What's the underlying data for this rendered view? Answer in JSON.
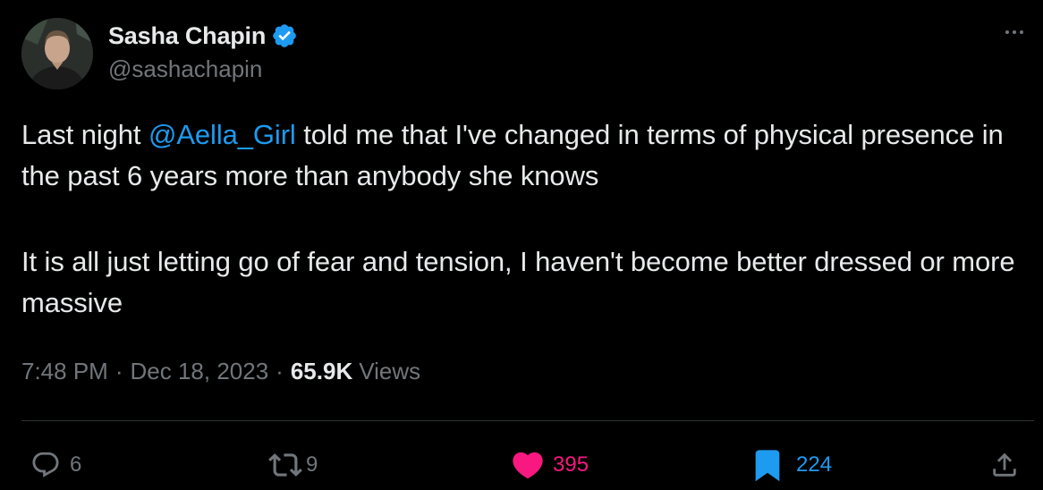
{
  "author": {
    "display_name": "Sasha Chapin",
    "handle": "@sashachapin",
    "verified": true,
    "avatar": "avatar-photo"
  },
  "tweet": {
    "paragraph1": {
      "before_mention": "Last night ",
      "mention": "@Aella_Girl",
      "after_mention": " told me that I've changed in terms of physical presence in the past 6 years more than anybody she knows"
    },
    "paragraph2": "It is all just letting go of fear and tension, I haven't become better dressed or more massive"
  },
  "meta": {
    "time": "7:48 PM",
    "separator": "·",
    "date": "Dec 18, 2023",
    "views_count": "65.9K",
    "views_label": "Views"
  },
  "actions": {
    "reply": {
      "icon": "reply-icon",
      "count": "6"
    },
    "retweet": {
      "icon": "retweet-icon",
      "count": "9"
    },
    "like": {
      "icon": "heart-icon",
      "count": "395"
    },
    "bookmark": {
      "icon": "bookmark-icon",
      "count": "224"
    },
    "share": {
      "icon": "share-icon"
    }
  },
  "colors": {
    "background": "#000000",
    "text": "#e7e9ea",
    "muted": "#71767b",
    "link": "#1d9bf0",
    "like": "#f91880",
    "divider": "#2f3336"
  }
}
